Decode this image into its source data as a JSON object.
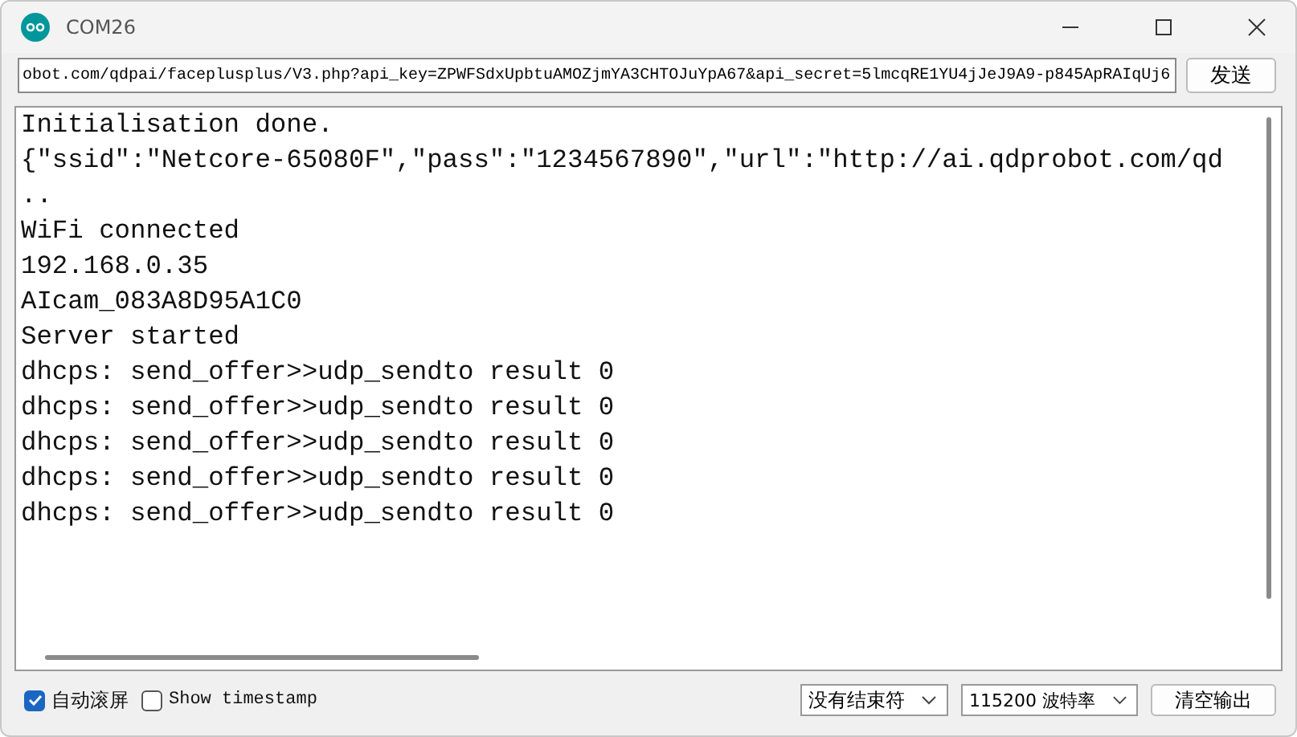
{
  "window": {
    "title": "COM26"
  },
  "send_field": {
    "value": "obot.com/qdpai/faceplusplus/V3.php?api_key=ZPWFSdxUpbtuAMOZjmYA3CHTOJuYpA67&api_secret=5lmcqRE1YU4jJeJ9A9-p845ApRAIqUj6"
  },
  "send_button": "发送",
  "output_lines": [
    "Initialisation done.",
    "{\"ssid\":\"Netcore-65080F\",\"pass\":\"1234567890\",\"url\":\"http://ai.qdprobot.com/qd",
    "..",
    "WiFi connected",
    "192.168.0.35",
    "AIcam_083A8D95A1C0",
    "Server started",
    "dhcps: send_offer>>udp_sendto result 0",
    "dhcps: send_offer>>udp_sendto result 0",
    "dhcps: send_offer>>udp_sendto result 0",
    "dhcps: send_offer>>udp_sendto result 0",
    "dhcps: send_offer>>udp_sendto result 0"
  ],
  "options": [
    {
      "label": "自动滚屏",
      "checked": true
    },
    {
      "label": "Show timestamp",
      "checked": false
    }
  ],
  "line_ending": "没有结束符",
  "baud_rate": "115200 波特率",
  "clear_button": "清空输出"
}
